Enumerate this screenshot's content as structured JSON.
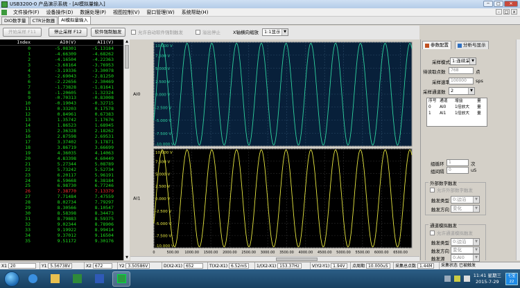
{
  "window": {
    "title": "USB3200-0 产品演示系统 - [AI模拟量输入]",
    "minimize_glyph": "─",
    "maximize_glyph": "□",
    "close_glyph": "✕"
  },
  "menu": {
    "items": [
      "文件操作(F)",
      "设备操作(D)",
      "数据处理(P)",
      "视图控制(V)",
      "窗口管理(W)",
      "系统帮助(H)"
    ],
    "mdi_minimize": "-",
    "mdi_restore": "□",
    "mdi_close": "x"
  },
  "tabs": [
    "DIO数字量",
    "CTR计数器",
    "AI模拟量输入"
  ],
  "toolbar": {
    "start_label": "开始采样 F11",
    "stop_label": "停止采样 F12",
    "soft_trigger_label": "软件强制触发",
    "auto_soft_trigger_label": "允许自动软件强制触发",
    "overflow_stop_label": "溢出停止",
    "x_zoom_label": "X轴横向缩放",
    "x_zoom_value": "1:1显示"
  },
  "table": {
    "headers": [
      "Index",
      "AI0(V)",
      "AI1(V)"
    ],
    "highlight_row": 26,
    "rows": [
      [
        "0",
        "-5.08301",
        "-5.13184"
      ],
      [
        "1",
        "-4.66309",
        "-4.68262"
      ],
      [
        "2",
        "-4.16504",
        "-4.22363"
      ],
      [
        "3",
        "-3.68164",
        "-3.76953"
      ],
      [
        "4",
        "-3.19336",
        "-3.30078"
      ],
      [
        "5",
        "-2.69043",
        "-2.81250"
      ],
      [
        "6",
        "-2.22656",
        "-2.30469"
      ],
      [
        "7",
        "-1.73828",
        "-1.81641"
      ],
      [
        "8",
        "-1.20605",
        "-1.32324"
      ],
      [
        "9",
        "-0.70313",
        "-0.83008"
      ],
      [
        "10",
        "-0.19043",
        "-0.32715"
      ],
      [
        "11",
        "0.33203",
        "0.17578"
      ],
      [
        "12",
        "0.84961",
        "0.67383"
      ],
      [
        "13",
        "1.35742",
        "1.17676"
      ],
      [
        "14",
        "1.86523",
        "1.68945"
      ],
      [
        "15",
        "2.36328",
        "2.18262"
      ],
      [
        "16",
        "2.87598",
        "2.69531"
      ],
      [
        "17",
        "3.37402",
        "3.17871"
      ],
      [
        "18",
        "3.86719",
        "3.66699"
      ],
      [
        "19",
        "4.36035",
        "4.14063"
      ],
      [
        "20",
        "4.83398",
        "4.60449"
      ],
      [
        "21",
        "5.27344",
        "5.08789"
      ],
      [
        "22",
        "5.73242",
        "5.52734"
      ],
      [
        "23",
        "6.20117",
        "5.96191"
      ],
      [
        "24",
        "6.59668",
        "6.38184"
      ],
      [
        "25",
        "6.98730",
        "6.77246"
      ],
      [
        "26",
        "7.38770",
        "7.13379"
      ],
      [
        "27",
        "7.71484",
        "7.47559"
      ],
      [
        "28",
        "8.02734",
        "7.79297"
      ],
      [
        "29",
        "8.30566",
        "8.10547"
      ],
      [
        "30",
        "8.58398",
        "8.34473"
      ],
      [
        "31",
        "8.79883",
        "8.59375"
      ],
      [
        "32",
        "9.02344",
        "8.78906"
      ],
      [
        "33",
        "9.19922",
        "8.99414"
      ],
      [
        "34",
        "9.37012",
        "9.16504"
      ],
      [
        "35",
        "9.51172",
        "9.30176"
      ]
    ]
  },
  "right_panel": {
    "tabs": [
      "参数配置",
      "分析与显示"
    ],
    "sample_mode_label": "采样模式",
    "sample_mode_value": "1:连续采",
    "points_label": "待读取点数",
    "points_value": "768",
    "points_unit": "点",
    "rate_label": "采样速率",
    "rate_value": "100000",
    "rate_unit": "sps",
    "channels_label": "采样通道数",
    "channels_value": "2",
    "channel_table": {
      "headers": [
        "序号",
        "通道",
        "增益",
        "量"
      ],
      "rows": [
        [
          "0",
          "AI0",
          "1倍放大",
          "量"
        ],
        [
          "1",
          "AI1",
          "1倍放大",
          "量"
        ]
      ]
    },
    "group_loop_label": "组循环",
    "group_loop_value": "1",
    "group_loop_unit": "次",
    "group_interval_label": "组间隔",
    "group_interval_value": "0",
    "group_interval_unit": "uS",
    "ext_trigger_title": "外部数字触发",
    "ext_allow_label": "允许外部数字触发",
    "ext_type_label": "触发类型",
    "ext_type_value": "0:边沿",
    "ext_dir_label": "触发方向",
    "ext_dir_value": "变化",
    "ana_trigger_title": "通道模拟触发",
    "ana_allow_label": "允许通道模拟触发",
    "ana_type_label": "触发类型",
    "ana_type_value": "0:边沿",
    "ana_dir_label": "触发方向",
    "ana_dir_value": "变化",
    "ana_source_label": "触发源",
    "ana_source_value": "0:AI0"
  },
  "status": {
    "x1_label": "X1",
    "x1_value": "20",
    "y1_label": "Y1",
    "y1_value": "5.56738V",
    "x2_label": "X2",
    "x2_value": "672",
    "y2_label": "Y2",
    "y2_value": "3.50586V",
    "dx_label": "D(X2-X1)",
    "dx_value": "652",
    "t_label": "T(X2-X1)",
    "t_value": "6.52mS",
    "f_label": "1/(X2-X1)",
    "f_value": "153.37Hz",
    "v_label": "V(Y2-Y1)",
    "v_value": "1.94V",
    "period_label": "点周期",
    "period_value": "10.000uS",
    "total_label": "采集总点数",
    "total_value": "1.44M",
    "state_label": "采集状态",
    "state_value": "已被触发"
  },
  "chart_data": {
    "type": "line",
    "x_ticks": [
      "0",
      "500.00",
      "1000.00",
      "1500.00",
      "2000.00",
      "2500.00",
      "3000.00",
      "3500.00",
      "4000.00",
      "4500.00",
      "5000.00",
      "5500.00",
      "6000.00",
      "6500.00"
    ],
    "xlim": [
      0,
      6800
    ],
    "channels": [
      {
        "name": "AI0",
        "y_ticks": [
          "10.000 V",
          "7.500 V",
          "5.000 V",
          "2.500 V",
          "0.000 V",
          "-2.500 V",
          "-5.000 V",
          "-7.500 V",
          "-10.000 V"
        ],
        "ylim": [
          -10,
          10
        ],
        "color": "#2ed3a0",
        "amplitude": 9.8,
        "period": 653,
        "phase_deg": -31
      },
      {
        "name": "AI1",
        "y_ticks": [
          "10.000 V",
          "7.500 V",
          "5.000 V",
          "2.500 V",
          "0.000 V",
          "-2.500 V",
          "-5.000 V",
          "-7.500 V",
          "-10.000 V"
        ],
        "ylim": [
          -10,
          10
        ],
        "color": "#e8e840",
        "amplitude": 9.8,
        "period": 653,
        "phase_deg": -31
      }
    ]
  },
  "taskbar": {
    "clock_time": "11:41 星期三",
    "clock_date": "2015-7-29",
    "ime_label": "七宝",
    "ime_num": "22"
  }
}
